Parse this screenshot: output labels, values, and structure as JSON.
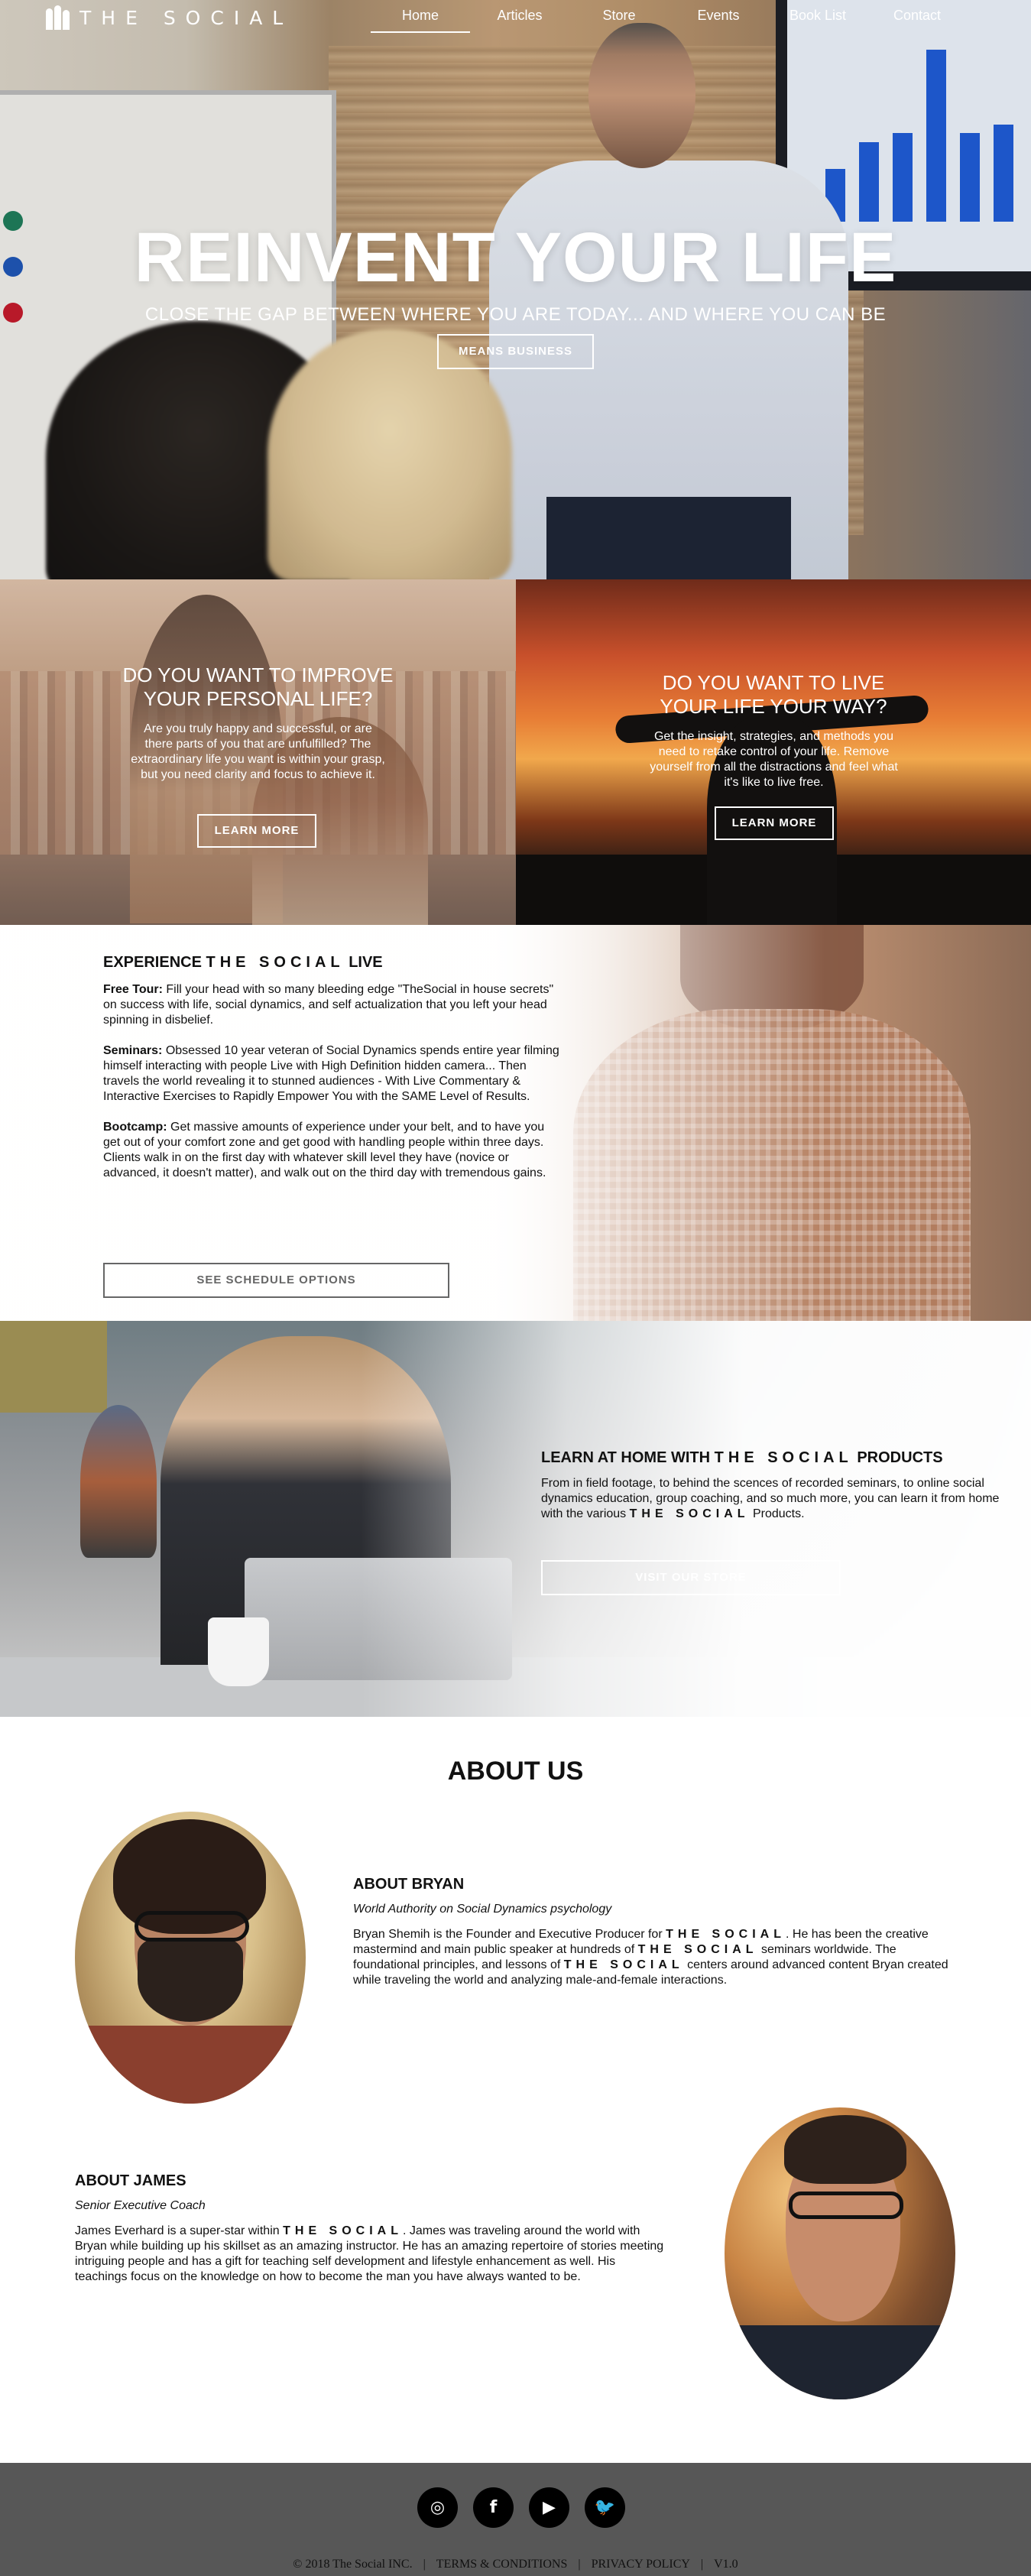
{
  "brand": {
    "name": "THE SOCIAL"
  },
  "nav": {
    "items": [
      {
        "label": "Home"
      },
      {
        "label": "Articles"
      },
      {
        "label": "Store"
      },
      {
        "label": "Events"
      },
      {
        "label": "Book List"
      },
      {
        "label": "Contact"
      }
    ],
    "active": "Home"
  },
  "hero": {
    "title": "REINVENT YOUR LIFE",
    "subtitle": "CLOSE THE GAP BETWEEN WHERE YOU ARE TODAY... AND WHERE YOU CAN BE",
    "button": "MEANS BUSINESS",
    "chart_values": [
      120,
      180,
      200,
      390,
      200,
      220
    ]
  },
  "panel_left": {
    "title": "DO YOU WANT TO IMPROVE YOUR PERSONAL LIFE?",
    "text": "Are you truly happy and successful, or are there parts of you that are unfulfilled? The extraordinary life you want is within your grasp, but you need clarity and focus to achieve it.",
    "button": "LEARN MORE"
  },
  "panel_right": {
    "title": "DO YOU WANT TO LIVE YOUR LIFE YOUR WAY?",
    "text": "Get the insight, strategies, and methods you need to retake control of your life. Remove yourself from all the distractions and feel what it's like to live free.",
    "button": "LEARN MORE"
  },
  "experience": {
    "heading_prefix": "EXPERIENCE",
    "heading_suffix": "LIVE",
    "paragraphs": [
      {
        "label": "Free Tour:",
        "text": " Fill your head with so many bleeding edge \"TheSocial in house secrets\" on success with life, social dynamics, and self actualization that you left your head spinning in disbelief."
      },
      {
        "label": "Seminars:",
        "text": " Obsessed 10 year veteran of Social Dynamics spends entire year filming himself interacting with people Live with High Definition hidden camera... Then travels the world revealing it to stunned audiences - With Live Commentary & Interactive Exercises to Rapidly Empower You with the SAME Level of Results."
      },
      {
        "label": "Bootcamp:",
        "text": " Get massive amounts of experience under your belt, and to have you get out of your comfort zone and get good with handling people within three days. Clients walk in on the first day with whatever skill level they have (novice or advanced, it doesn't matter), and walk out on the third day with tremendous gains."
      }
    ],
    "button": "SEE SCHEDULE OPTIONS"
  },
  "learn": {
    "heading_prefix": "LEARN AT HOME WITH",
    "heading_suffix": "PRODUCTS",
    "text_prefix": "From in field footage, to behind the scences of recorded seminars, to online social dynamics education, group coaching, and so much more, you can learn it from home with the various",
    "text_suffix": "Products.",
    "button": "VISIT OUR STORE"
  },
  "about": {
    "title": "ABOUT US",
    "bryan": {
      "name": "ABOUT BRYAN",
      "role": "World Authority on Social Dynamics psychology",
      "text_a": "Bryan Shemih is the Founder and Executive Producer for",
      "text_b": ". He has been the creative mastermind and main public speaker at hundreds of",
      "text_c": "seminars worldwide. The foundational principles, and lessons of",
      "text_d": "centers around advanced content Bryan created while traveling the world and analyzing male-and-female interactions."
    },
    "james": {
      "name": "ABOUT JAMES",
      "role": "Senior Executive Coach",
      "text_a": "James Everhard is a super-star within",
      "text_b": ". James was traveling around the world with Bryan while building up his skillset as an amazing instructor. He has an amazing repertoire of stories meeting intriguing people and has a gift for teaching self development and lifestyle enhancement as well. His teachings focus on the knowledge on how to become the man you have always wanted to be."
    }
  },
  "footer": {
    "social": [
      {
        "icon": "instagram-icon",
        "glyph": "◎"
      },
      {
        "icon": "facebook-icon",
        "glyph": "f"
      },
      {
        "icon": "youtube-icon",
        "glyph": "▶"
      },
      {
        "icon": "twitter-icon",
        "glyph": "🐦"
      }
    ],
    "copyright": "© 2018 The Social INC.",
    "terms": "TERMS & CONDITIONS",
    "privacy": "PRIVACY POLICY",
    "version": "V1.0",
    "separator": "|"
  },
  "colors": {
    "footer_bg": "#575757",
    "chart_bar": "#1f5bd4"
  }
}
